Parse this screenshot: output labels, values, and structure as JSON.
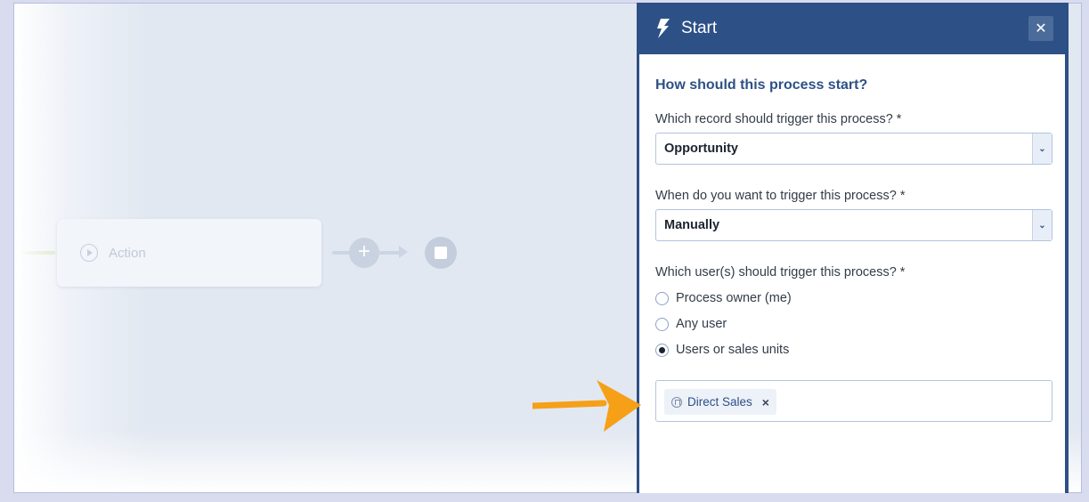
{
  "canvas": {
    "action_node_label": "Action",
    "plus_symbol": "+",
    "icons": [
      "play-icon",
      "plus-icon",
      "stop-icon"
    ],
    "colors": {
      "node_fill": "#f2f5fa",
      "connector": "#ccd5e3",
      "stop": "#c3cddc"
    }
  },
  "panel": {
    "title": "Start",
    "icon": "lightning-bolt-icon",
    "close_symbol": "✕",
    "colors": {
      "header": "#2d5086",
      "accent_text": "#2d5086"
    },
    "section_title": "How should this process start?",
    "record_field": {
      "label": "Which record should trigger this process? *",
      "value": "Opportunity"
    },
    "trigger_field": {
      "label": "When do you want to trigger this process? *",
      "value": "Manually"
    },
    "users_field": {
      "label": "Which user(s) should trigger this process? *",
      "options": [
        {
          "label": "Process owner (me)",
          "selected": false
        },
        {
          "label": "Any user",
          "selected": false
        },
        {
          "label": "Users or sales units",
          "selected": true
        }
      ]
    },
    "selected_units": {
      "tags": [
        {
          "label": "Direct Sales",
          "remove_symbol": "×"
        }
      ]
    }
  },
  "annotation": {
    "color": "#f5a017",
    "icon": "pointer-arrow"
  }
}
